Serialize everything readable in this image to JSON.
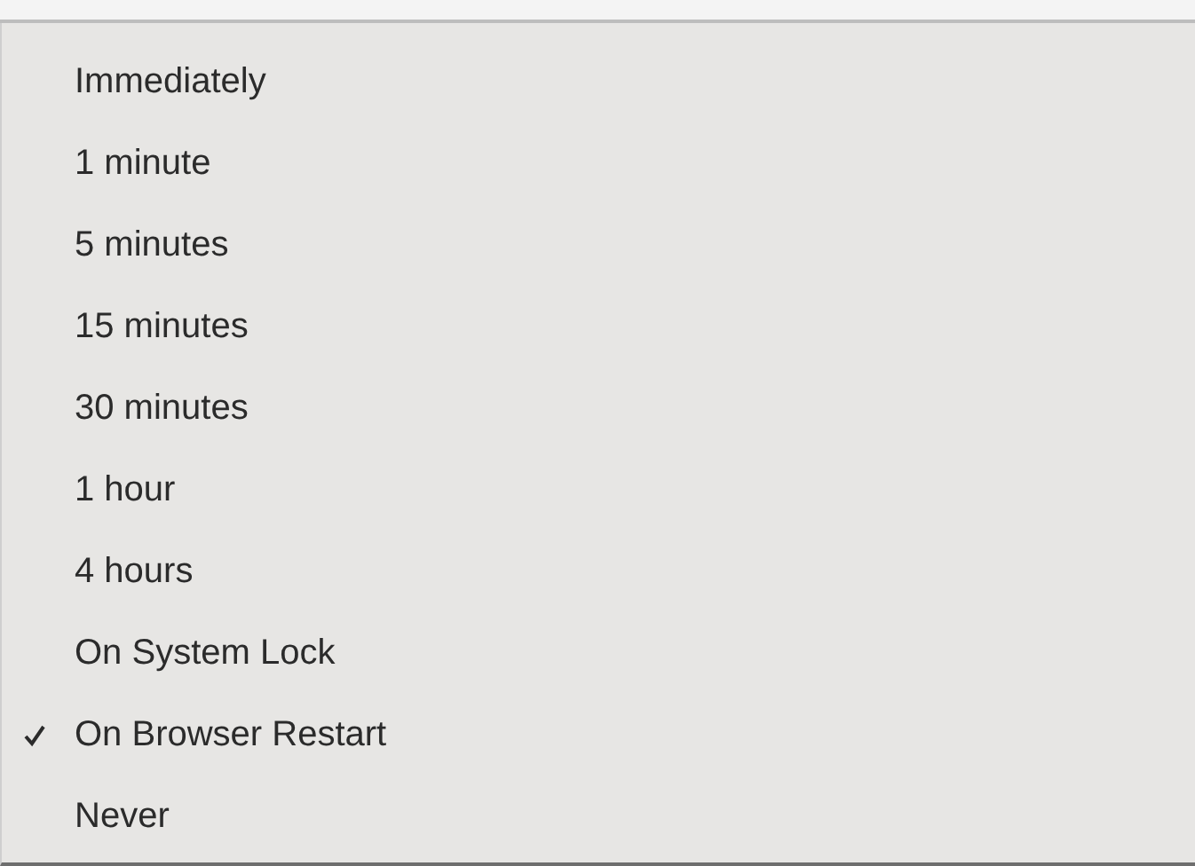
{
  "menu": {
    "options": [
      {
        "label": "Immediately",
        "selected": false
      },
      {
        "label": "1 minute",
        "selected": false
      },
      {
        "label": "5 minutes",
        "selected": false
      },
      {
        "label": "15 minutes",
        "selected": false
      },
      {
        "label": "30 minutes",
        "selected": false
      },
      {
        "label": "1 hour",
        "selected": false
      },
      {
        "label": "4 hours",
        "selected": false
      },
      {
        "label": "On System Lock",
        "selected": false
      },
      {
        "label": "On Browser Restart",
        "selected": true
      },
      {
        "label": "Never",
        "selected": false
      }
    ]
  }
}
